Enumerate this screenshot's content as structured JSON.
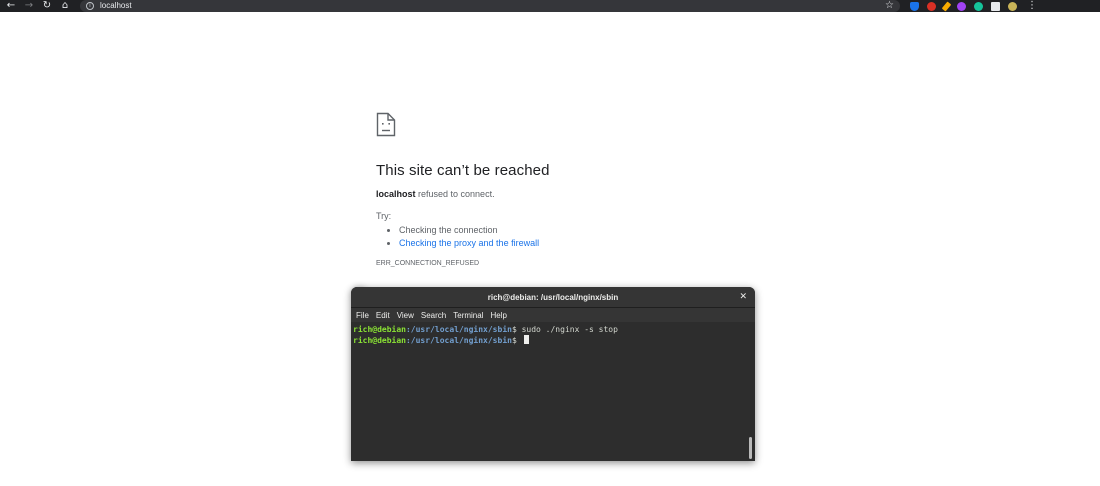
{
  "browser": {
    "url": "localhost",
    "menu_glyph": "⋮"
  },
  "error_page": {
    "title": "This site can’t be reached",
    "host": "localhost",
    "description_suffix": " refused to connect.",
    "try_label": "Try:",
    "suggestions": [
      "Checking the connection",
      "Checking the proxy and the firewall"
    ],
    "error_code": "ERR_CONNECTION_REFUSED"
  },
  "terminal": {
    "title": "rich@debian: /usr/local/nginx/sbin",
    "menu": [
      "File",
      "Edit",
      "View",
      "Search",
      "Terminal",
      "Help"
    ],
    "lines": [
      {
        "user": "rich@debian",
        "path": ":/usr/local/nginx/sbin",
        "symbol": "$ ",
        "command": "sudo ./nginx -s stop"
      },
      {
        "user": "rich@debian",
        "path": ":/usr/local/nginx/sbin",
        "symbol": "$ ",
        "command": ""
      }
    ]
  },
  "extensions": [
    {
      "name": "shield-extension-icon",
      "color": "#1a73e8"
    },
    {
      "name": "alert-extension-icon",
      "color": "#d93025"
    },
    {
      "name": "pencil-extension-icon",
      "color": "#f9ab00"
    },
    {
      "name": "palette-extension-icon",
      "color": "#a142f4"
    },
    {
      "name": "grammarly-extension-icon",
      "color": "#15c39a"
    },
    {
      "name": "terminal-extension-icon",
      "color": "#4a90d9"
    },
    {
      "name": "puzzle-extension-icon",
      "color": "#e8eaed"
    },
    {
      "name": "avatar-icon",
      "color": "#c9b458"
    }
  ]
}
